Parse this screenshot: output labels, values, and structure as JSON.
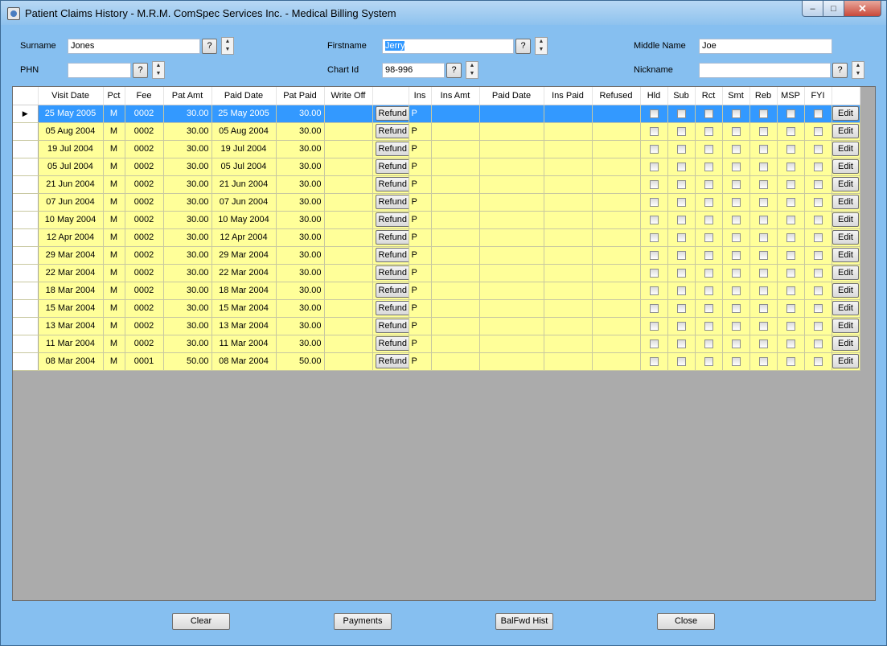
{
  "window": {
    "title": "Patient Claims History - M.R.M. ComSpec Services Inc. - Medical Billing System",
    "min_glyph": "–",
    "max_glyph": "□",
    "close_glyph": "✕"
  },
  "form": {
    "surname_label": "Surname",
    "surname_value": "Jones",
    "firstname_label": "Firstname",
    "firstname_value": "Jerry",
    "middle_label": "Middle Name",
    "middle_value": "Joe",
    "phn_label": "PHN",
    "phn_value": "",
    "chart_label": "Chart Id",
    "chart_value": "98-996",
    "nickname_label": "Nickname",
    "nickname_value": "",
    "lookup_label": "?",
    "spin_up": "▲",
    "spin_down": "▼"
  },
  "grid": {
    "columns": [
      "",
      "Visit Date",
      "Pct",
      "Fee",
      "Pat Amt",
      "Paid Date",
      "Pat Paid",
      "Write Off",
      "",
      "Ins",
      "Ins Amt",
      "Paid Date",
      "Ins Paid",
      "Refused",
      "Hld",
      "Sub",
      "Rct",
      "Smt",
      "Reb",
      "MSP",
      "FYI",
      ""
    ],
    "refund_label": "Refund",
    "edit_label": "Edit",
    "current_row_marker": "▶",
    "rows": [
      {
        "visit": "25 May 2005",
        "pct": "M",
        "fee": "0002",
        "pat_amt": "30.00",
        "paid_date": "25 May 2005",
        "pat_paid": "30.00",
        "write_off": "",
        "ins": "P",
        "ins_amt": "",
        "ins_paid_date": "",
        "ins_paid": "",
        "refused": ""
      },
      {
        "visit": "05 Aug 2004",
        "pct": "M",
        "fee": "0002",
        "pat_amt": "30.00",
        "paid_date": "05 Aug 2004",
        "pat_paid": "30.00",
        "write_off": "",
        "ins": "P",
        "ins_amt": "",
        "ins_paid_date": "",
        "ins_paid": "",
        "refused": ""
      },
      {
        "visit": "19 Jul 2004",
        "pct": "M",
        "fee": "0002",
        "pat_amt": "30.00",
        "paid_date": "19 Jul 2004",
        "pat_paid": "30.00",
        "write_off": "",
        "ins": "P",
        "ins_amt": "",
        "ins_paid_date": "",
        "ins_paid": "",
        "refused": ""
      },
      {
        "visit": "05 Jul 2004",
        "pct": "M",
        "fee": "0002",
        "pat_amt": "30.00",
        "paid_date": "05 Jul 2004",
        "pat_paid": "30.00",
        "write_off": "",
        "ins": "P",
        "ins_amt": "",
        "ins_paid_date": "",
        "ins_paid": "",
        "refused": ""
      },
      {
        "visit": "21 Jun 2004",
        "pct": "M",
        "fee": "0002",
        "pat_amt": "30.00",
        "paid_date": "21 Jun 2004",
        "pat_paid": "30.00",
        "write_off": "",
        "ins": "P",
        "ins_amt": "",
        "ins_paid_date": "",
        "ins_paid": "",
        "refused": ""
      },
      {
        "visit": "07 Jun 2004",
        "pct": "M",
        "fee": "0002",
        "pat_amt": "30.00",
        "paid_date": "07 Jun 2004",
        "pat_paid": "30.00",
        "write_off": "",
        "ins": "P",
        "ins_amt": "",
        "ins_paid_date": "",
        "ins_paid": "",
        "refused": ""
      },
      {
        "visit": "10 May 2004",
        "pct": "M",
        "fee": "0002",
        "pat_amt": "30.00",
        "paid_date": "10 May 2004",
        "pat_paid": "30.00",
        "write_off": "",
        "ins": "P",
        "ins_amt": "",
        "ins_paid_date": "",
        "ins_paid": "",
        "refused": ""
      },
      {
        "visit": "12 Apr 2004",
        "pct": "M",
        "fee": "0002",
        "pat_amt": "30.00",
        "paid_date": "12 Apr 2004",
        "pat_paid": "30.00",
        "write_off": "",
        "ins": "P",
        "ins_amt": "",
        "ins_paid_date": "",
        "ins_paid": "",
        "refused": ""
      },
      {
        "visit": "29 Mar 2004",
        "pct": "M",
        "fee": "0002",
        "pat_amt": "30.00",
        "paid_date": "29 Mar 2004",
        "pat_paid": "30.00",
        "write_off": "",
        "ins": "P",
        "ins_amt": "",
        "ins_paid_date": "",
        "ins_paid": "",
        "refused": ""
      },
      {
        "visit": "22 Mar 2004",
        "pct": "M",
        "fee": "0002",
        "pat_amt": "30.00",
        "paid_date": "22 Mar 2004",
        "pat_paid": "30.00",
        "write_off": "",
        "ins": "P",
        "ins_amt": "",
        "ins_paid_date": "",
        "ins_paid": "",
        "refused": ""
      },
      {
        "visit": "18 Mar 2004",
        "pct": "M",
        "fee": "0002",
        "pat_amt": "30.00",
        "paid_date": "18 Mar 2004",
        "pat_paid": "30.00",
        "write_off": "",
        "ins": "P",
        "ins_amt": "",
        "ins_paid_date": "",
        "ins_paid": "",
        "refused": ""
      },
      {
        "visit": "15 Mar 2004",
        "pct": "M",
        "fee": "0002",
        "pat_amt": "30.00",
        "paid_date": "15 Mar 2004",
        "pat_paid": "30.00",
        "write_off": "",
        "ins": "P",
        "ins_amt": "",
        "ins_paid_date": "",
        "ins_paid": "",
        "refused": ""
      },
      {
        "visit": "13 Mar 2004",
        "pct": "M",
        "fee": "0002",
        "pat_amt": "30.00",
        "paid_date": "13 Mar 2004",
        "pat_paid": "30.00",
        "write_off": "",
        "ins": "P",
        "ins_amt": "",
        "ins_paid_date": "",
        "ins_paid": "",
        "refused": ""
      },
      {
        "visit": "11 Mar 2004",
        "pct": "M",
        "fee": "0002",
        "pat_amt": "30.00",
        "paid_date": "11 Mar 2004",
        "pat_paid": "30.00",
        "write_off": "",
        "ins": "P",
        "ins_amt": "",
        "ins_paid_date": "",
        "ins_paid": "",
        "refused": ""
      },
      {
        "visit": "08 Mar 2004",
        "pct": "M",
        "fee": "0001",
        "pat_amt": "50.00",
        "paid_date": "08 Mar 2004",
        "pat_paid": "50.00",
        "write_off": "",
        "ins": "P",
        "ins_amt": "",
        "ins_paid_date": "",
        "ins_paid": "",
        "refused": ""
      }
    ]
  },
  "buttons": {
    "clear": "Clear",
    "payments": "Payments",
    "balfwd": "BalFwd Hist",
    "close": "Close"
  },
  "colors": {
    "window_bg": "#86bff0",
    "row_bg": "#ffff99",
    "selected_row": "#3399ff",
    "empty_grid": "#ababab"
  }
}
